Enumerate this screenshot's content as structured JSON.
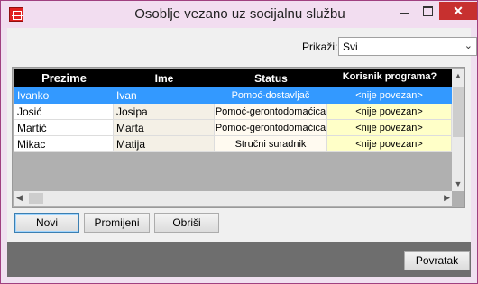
{
  "window": {
    "title": "Osoblje vezano uz socijalnu službu",
    "close_label": "✕"
  },
  "filter": {
    "label": "Prikaži:",
    "selected": "Svi",
    "arrow": "⌄"
  },
  "grid": {
    "columns": [
      "Prezime",
      "Ime",
      "Status",
      "Korisnik programa?"
    ],
    "rows": [
      {
        "prezime": "Ivanko",
        "ime": "Ivan",
        "status": "Pomoć-dostavljač",
        "korisnik": "<nije povezan>"
      },
      {
        "prezime": "Josić",
        "ime": "Josipa",
        "status": "Pomoć-gerontodomaćica",
        "korisnik": "<nije povezan>"
      },
      {
        "prezime": "Martić",
        "ime": "Marta",
        "status": "Pomoć-gerontodomaćica",
        "korisnik": "<nije povezan>"
      },
      {
        "prezime": "Mikac",
        "ime": "Matija",
        "status": "Stručni suradnik",
        "korisnik": "<nije povezan>"
      }
    ],
    "selected_row_index": 0
  },
  "buttons": {
    "novi": "Novi",
    "promijeni": "Promijeni",
    "obrisi": "Obriši",
    "povratak": "Povratak"
  },
  "icons": {
    "up": "▲",
    "down": "▼",
    "left": "◀",
    "right": "▶"
  },
  "colors": {
    "selection": "#3399ff",
    "close_button": "#c7302f",
    "korisnik_column": "#ffffc8"
  }
}
